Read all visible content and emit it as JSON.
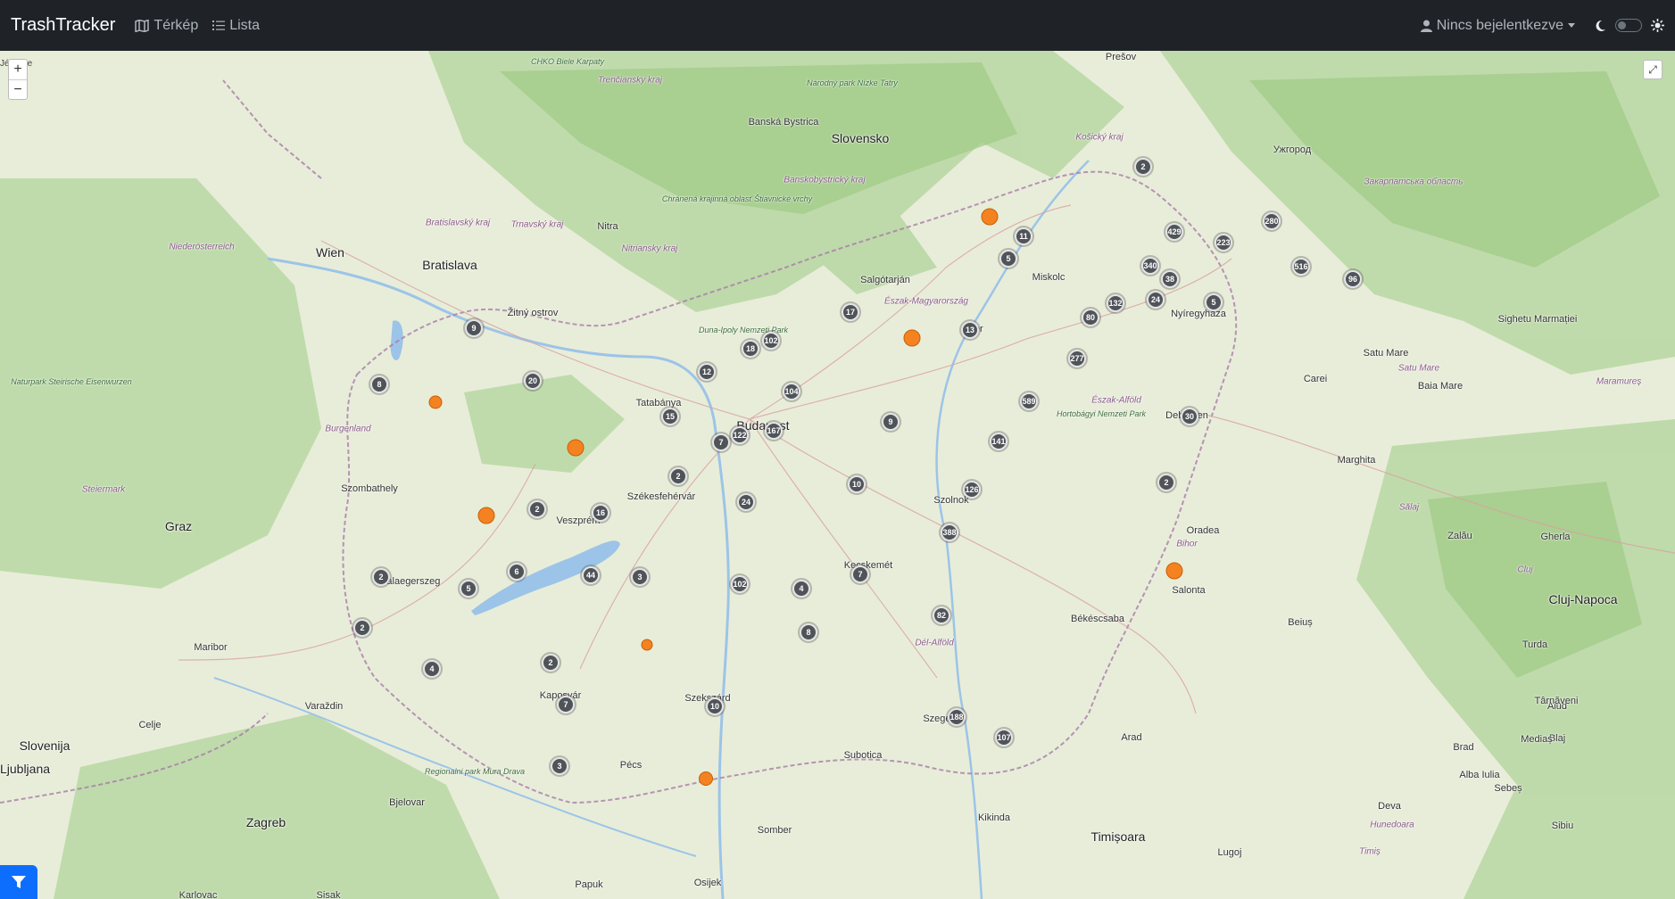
{
  "navbar": {
    "brand": "TrashTracker",
    "links": [
      {
        "label": "Térkép",
        "icon": "map-icon"
      },
      {
        "label": "Lista",
        "icon": "list-icon"
      }
    ],
    "user_label": "Nincs bejelentkezve",
    "theme_icons": [
      "moon-icon",
      "sun-icon"
    ]
  },
  "map": {
    "zoom_in": "+",
    "zoom_out": "−",
    "fullscreen": "⤢",
    "corner_label": "Jéjovice",
    "colors": {
      "cluster": "#4f5459",
      "marker": "#f58220",
      "filter_button": "#0d6efd"
    },
    "places": [
      {
        "name": "Wien",
        "big": true
      },
      {
        "name": "Bratislava",
        "big": true
      },
      {
        "name": "Budapest",
        "big": true
      },
      {
        "name": "Slovensko",
        "big": true
      },
      {
        "name": "Graz",
        "big": true
      },
      {
        "name": "Zagreb",
        "big": true
      },
      {
        "name": "Ljubljana",
        "big": true
      },
      {
        "name": "Slovenija",
        "big": true
      },
      {
        "name": "Cluj-Napoca",
        "big": true
      },
      {
        "name": "Timișoara",
        "big": true
      },
      {
        "name": "Banská Bystrica"
      },
      {
        "name": "Nitra"
      },
      {
        "name": "Žitný ostrov"
      },
      {
        "name": "Salgótarján"
      },
      {
        "name": "Miskolc"
      },
      {
        "name": "Nyíregyháza"
      },
      {
        "name": "Debrecen"
      },
      {
        "name": "Eger"
      },
      {
        "name": "Tatabánya"
      },
      {
        "name": "Székesfehérvár"
      },
      {
        "name": "Veszprém"
      },
      {
        "name": "Szombathely"
      },
      {
        "name": "Zalaegerszeg"
      },
      {
        "name": "Kaposvár"
      },
      {
        "name": "Pécs"
      },
      {
        "name": "Szekszárd"
      },
      {
        "name": "Kecskemét"
      },
      {
        "name": "Szolnok"
      },
      {
        "name": "Szeged"
      },
      {
        "name": "Békéscsaba"
      },
      {
        "name": "Salonta"
      },
      {
        "name": "Oradea"
      },
      {
        "name": "Arad"
      },
      {
        "name": "Subotica"
      },
      {
        "name": "Osijek"
      },
      {
        "name": "Maribor"
      },
      {
        "name": "Varaždin"
      },
      {
        "name": "Celje"
      },
      {
        "name": "Bjelovar"
      },
      {
        "name": "Kikinda"
      },
      {
        "name": "Somber"
      },
      {
        "name": "Lugoj"
      },
      {
        "name": "Deva"
      },
      {
        "name": "Brad"
      },
      {
        "name": "Beiuș"
      },
      {
        "name": "Zalău"
      },
      {
        "name": "Carei"
      },
      {
        "name": "Satu Mare"
      },
      {
        "name": "Baia Mare"
      },
      {
        "name": "Sighetu Marmației"
      },
      {
        "name": "Marghita"
      },
      {
        "name": "Turda"
      },
      {
        "name": "Aiud"
      },
      {
        "name": "Blaj"
      },
      {
        "name": "Alba Iulia"
      },
      {
        "name": "Sebeș"
      },
      {
        "name": "Sibiu"
      },
      {
        "name": "Mediaș"
      },
      {
        "name": "Târnăveni"
      },
      {
        "name": "Gherla"
      },
      {
        "name": "Prešov"
      },
      {
        "name": "Ужгород"
      },
      {
        "name": "Burgenland"
      },
      {
        "name": "Steiermark"
      },
      {
        "name": "Niederösterreich"
      },
      {
        "name": "Észak-Magyarország"
      },
      {
        "name": "Észak-Alföld"
      },
      {
        "name": "Dél-Alföld"
      },
      {
        "name": "Košický kraj"
      },
      {
        "name": "Banskobystrický kraj"
      },
      {
        "name": "Nitriansky kraj"
      },
      {
        "name": "Trnavský kraj"
      },
      {
        "name": "Bratislavský kraj"
      },
      {
        "name": "Trenčiansky kraj"
      },
      {
        "name": "Закарпатська область"
      },
      {
        "name": "Bihor"
      },
      {
        "name": "Sălaj"
      },
      {
        "name": "Cluj"
      },
      {
        "name": "Maramureș"
      },
      {
        "name": "Satu Mare"
      },
      {
        "name": "Hunedoara"
      },
      {
        "name": "Timiș"
      },
      {
        "name": "Duna-Ipoly Nemzeti Park"
      },
      {
        "name": "Hortobágyi Nemzeti Park"
      },
      {
        "name": "Regionalni park Mura Drava"
      },
      {
        "name": "Naturpark Steirische Eisenwurzen"
      },
      {
        "name": "Chránená krajinná oblasť Štiavnické vrchy"
      },
      {
        "name": "Národný park Nízke Tatry"
      },
      {
        "name": "CHKO Biele Karpaty"
      },
      {
        "name": "Papuk"
      },
      {
        "name": "Sisak"
      },
      {
        "name": "Karlovac"
      }
    ],
    "clusters": [
      "2",
      "11",
      "5",
      "429",
      "223",
      "280",
      "340",
      "38",
      "516",
      "96",
      "24",
      "5",
      "132",
      "80",
      "17",
      "13",
      "277",
      "102",
      "18",
      "9",
      "12",
      "8",
      "20",
      "104",
      "589",
      "15",
      "7",
      "122",
      "167",
      "9",
      "141",
      "2",
      "2",
      "126",
      "10",
      "24",
      "2",
      "16",
      "388",
      "6",
      "44",
      "3",
      "102",
      "4",
      "7",
      "5",
      "2",
      "82",
      "2",
      "8",
      "4",
      "2",
      "7",
      "10",
      "188",
      "107",
      "3",
      "30"
    ],
    "orange_markers": 9
  },
  "filter_button": {
    "icon": "filter-icon"
  }
}
